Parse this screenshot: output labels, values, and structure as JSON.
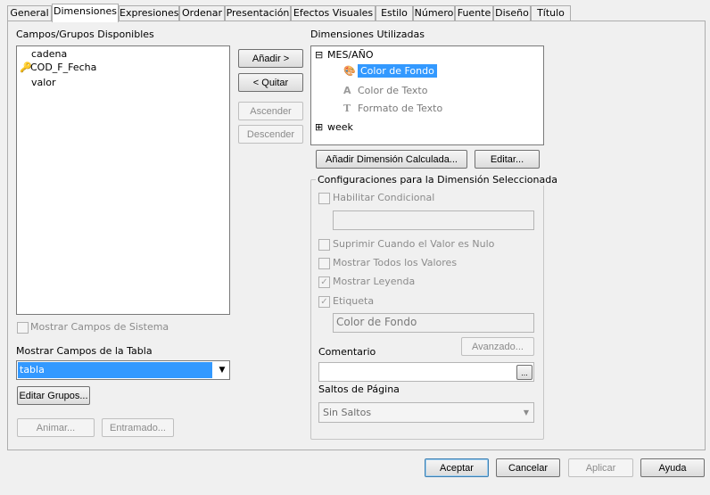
{
  "tabs": [
    {
      "label": "General",
      "active": false
    },
    {
      "label": "Dimensiones",
      "active": true
    },
    {
      "label": "Expresiones",
      "active": false
    },
    {
      "label": "Ordenar",
      "active": false
    },
    {
      "label": "Presentación",
      "active": false
    },
    {
      "label": "Efectos Visuales",
      "active": false
    },
    {
      "label": "Estilo",
      "active": false
    },
    {
      "label": "Número",
      "active": false
    },
    {
      "label": "Fuente",
      "active": false
    },
    {
      "label": "Diseño",
      "active": false
    },
    {
      "label": "Título",
      "active": false
    }
  ],
  "available": {
    "title": "Campos/Grupos Disponibles",
    "items": [
      "cadena",
      "COD_F_Fecha",
      "valor"
    ],
    "key_icon": "key-icon"
  },
  "center_buttons": {
    "add": "Añadir >",
    "remove": "< Quitar",
    "up": "Ascender",
    "down": "Descender"
  },
  "used": {
    "title": "Dimensiones Utilizadas",
    "items": [
      {
        "label": "MES/AÑO",
        "toggle": "⊟"
      },
      {
        "label": "Color de Fondo",
        "icon": "palette-icon",
        "selected": true
      },
      {
        "label": "Color de Texto",
        "icon": "text-color-icon"
      },
      {
        "label": "Formato de Texto",
        "icon": "text-format-icon"
      },
      {
        "label": "week",
        "toggle": "⊞"
      }
    ]
  },
  "calc_buttons": {
    "add_calc": "Añadir Dimensión Calculada...",
    "edit": "Editar..."
  },
  "config": {
    "title": "Configuraciones para la Dimensión Seleccionada",
    "enable_conditional": "Habilitar Condicional",
    "suppress_null": "Suprimir Cuando el Valor es Nulo",
    "show_all": "Mostrar Todos los Valores",
    "show_legend": "Mostrar Leyenda",
    "label": "Etiqueta",
    "label_value": "Color de Fondo",
    "advanced": "Avanzado...",
    "comment": "Comentario",
    "ellipsis": "...",
    "page_breaks": "Saltos de Página",
    "page_breaks_value": "Sin Saltos"
  },
  "left_bottom": {
    "show_system": "Mostrar Campos de Sistema",
    "show_table_fields": "Mostrar Campos de la Tabla",
    "table_value": "tabla",
    "edit_groups": "Editar Grupos...",
    "animate": "Animar...",
    "trellis": "Entramado..."
  },
  "footer": {
    "accept": "Aceptar",
    "cancel": "Cancelar",
    "apply": "Aplicar",
    "help": "Ayuda"
  },
  "colors": {
    "selection": "#3399ff",
    "dropdown_selected": "#3399ff"
  }
}
